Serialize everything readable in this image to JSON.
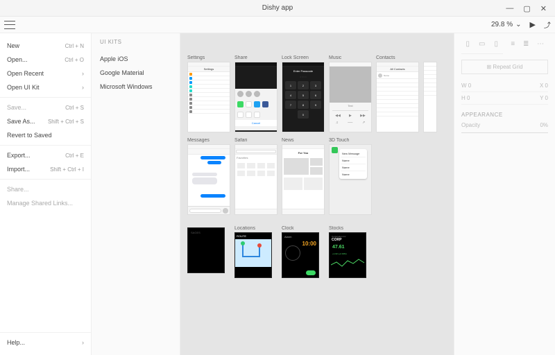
{
  "window": {
    "title": "Dishy app"
  },
  "winctrls": {
    "min": "—",
    "max": "▢",
    "close": "✕"
  },
  "toolbar": {
    "zoom": "29.8 %",
    "chev": "⌄",
    "play": "▶",
    "share": "⤴"
  },
  "menu": {
    "new": {
      "label": "New",
      "shortcut": "Ctrl + N"
    },
    "open": {
      "label": "Open...",
      "shortcut": "Ctrl + O"
    },
    "recent": {
      "label": "Open Recent"
    },
    "uikit": {
      "label": "Open UI Kit"
    },
    "save": {
      "label": "Save...",
      "shortcut": "Ctrl + S"
    },
    "saveas": {
      "label": "Save As...",
      "shortcut": "Shift + Ctrl + S"
    },
    "revert": {
      "label": "Revert to Saved"
    },
    "export": {
      "label": "Export...",
      "shortcut": "Ctrl + E"
    },
    "import": {
      "label": "Import...",
      "shortcut": "Shift + Ctrl + I"
    },
    "sharemenu": {
      "label": "Share..."
    },
    "shared": {
      "label": "Manage Shared Links..."
    },
    "help": {
      "label": "Help..."
    }
  },
  "uikits": {
    "header": "UI KITS",
    "items": [
      "Apple iOS",
      "Google Material",
      "Microsoft Windows"
    ]
  },
  "artboards": {
    "row1": [
      "Settings",
      "Share",
      "Lock Screen",
      "Music",
      "Contacts"
    ],
    "row2": [
      "Messages",
      "Safari",
      "News",
      "3D Touch"
    ],
    "row3": [
      "",
      "Locations",
      "Clock",
      "Stocks"
    ]
  },
  "mock": {
    "settings_title": "Settings",
    "share_cancel": "Cancel",
    "lock_title": "Enter Passcode",
    "keypad": [
      "1",
      "2",
      "3",
      "4",
      "5",
      "6",
      "7",
      "8",
      "9",
      "",
      "0",
      ""
    ],
    "mus_text": "Text",
    "contacts_title": "All Contacts",
    "safari_title": "Favorites",
    "news_title": "For You",
    "clock_label": "Alarm",
    "clock_time": "10:00",
    "loc_label": "ROUTE",
    "stock_label": "Corporation Inc",
    "stock_sym": "CORP",
    "stock_val": "47.61",
    "stock_delta": "+1.02 (+2.19%)",
    "threeD_items": [
      "New Message",
      "Name",
      "Name",
      "Name"
    ]
  },
  "panel": {
    "repeat": "Repeat Grid",
    "w": "W",
    "wval": "0",
    "x": "X",
    "xval": "0",
    "h": "H",
    "hval": "0",
    "y": "Y",
    "yval": "0",
    "appearance": "APPEARANCE",
    "opacity_label": "Opacity",
    "opacity_val": "0%"
  }
}
